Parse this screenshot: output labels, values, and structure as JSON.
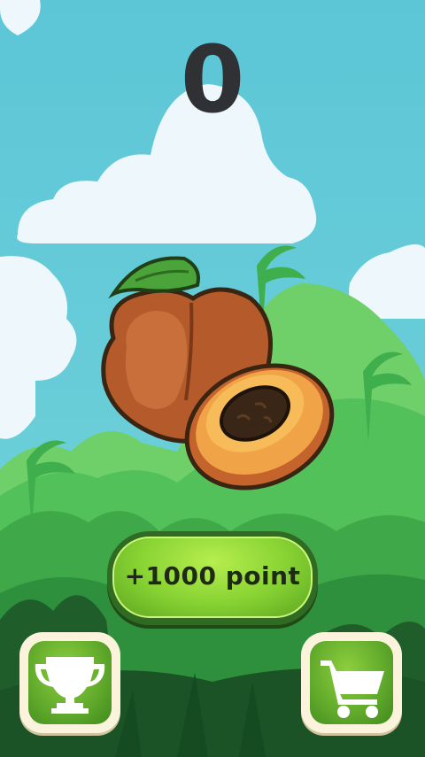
{
  "score": "0",
  "reward_button": {
    "label": "+1000 point"
  },
  "buttons": {
    "leaderboard": "trophy-icon",
    "shop": "cart-icon"
  },
  "colors": {
    "sky": "#5fc8d8",
    "button_green": "#86d232",
    "score_text": "#2f3134"
  }
}
